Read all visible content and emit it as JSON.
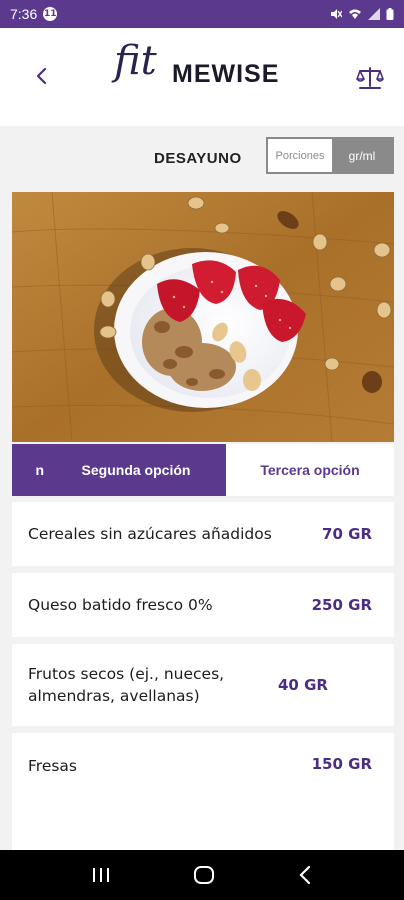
{
  "status_bar": {
    "time": "7:36",
    "notification_count": "11",
    "icons": [
      "mute-icon",
      "wifi-icon",
      "signal-icon",
      "battery-icon"
    ]
  },
  "header": {
    "logo_script": "fit",
    "logo_word": "MEWISE",
    "back_icon": "chevron-left-icon",
    "scale_icon": "balance-scale-icon"
  },
  "meal": {
    "title": "DESAYUNO",
    "unit_options": [
      "Porciones",
      "gr/ml"
    ],
    "selected_unit": "gr/ml"
  },
  "tabs": [
    {
      "label": "n"
    },
    {
      "label": "Segunda opción"
    },
    {
      "label": "Tercera opción"
    }
  ],
  "ingredients": [
    {
      "name": "Cereales sin azúcares añadidos",
      "qty": "70 GR"
    },
    {
      "name": "Queso batido fresco 0%",
      "qty": "250 GR"
    },
    {
      "name": "Frutos secos (ej., nueces, almendras, avellanas)",
      "qty": "40 GR"
    },
    {
      "name": "Fresas",
      "qty": "150 GR"
    }
  ],
  "colors": {
    "brand": "#5b3a8e",
    "accent_text": "#4b2e83",
    "toggle_gray": "#8a8a8a"
  },
  "nav": {
    "icons": [
      "recent-apps-icon",
      "home-icon",
      "back-icon"
    ]
  }
}
